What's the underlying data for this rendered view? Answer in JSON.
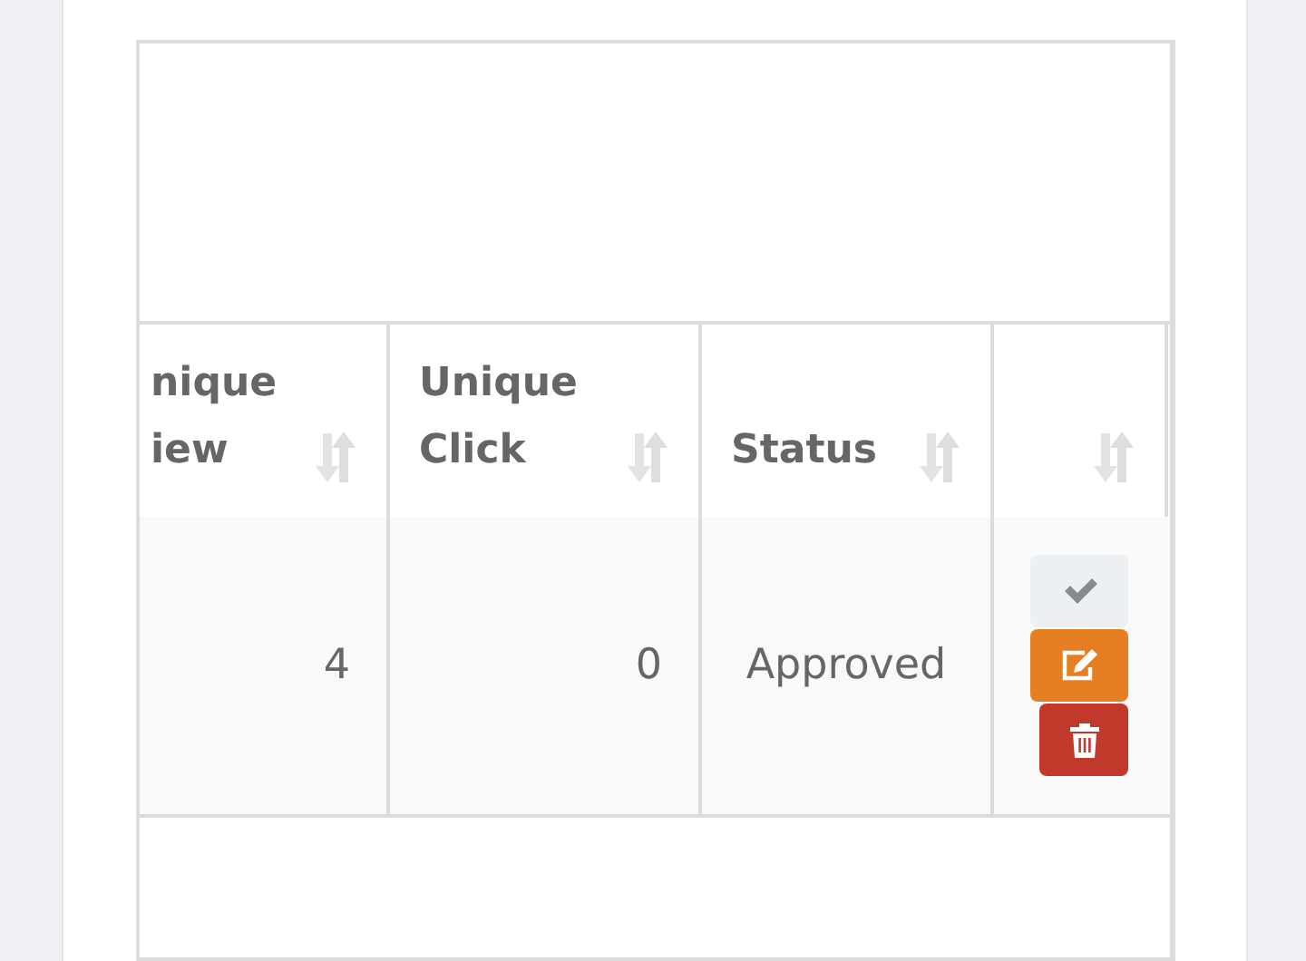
{
  "table": {
    "columns": [
      {
        "label": "nique iew"
      },
      {
        "label": "Unique Click"
      },
      {
        "label": "Status"
      },
      {}
    ],
    "rows": [
      {
        "cells": [
          "4",
          "0",
          "Approved"
        ],
        "actions": [
          {
            "kind": "approve"
          },
          {
            "kind": "edit"
          },
          {
            "kind": "delete"
          }
        ]
      }
    ]
  }
}
